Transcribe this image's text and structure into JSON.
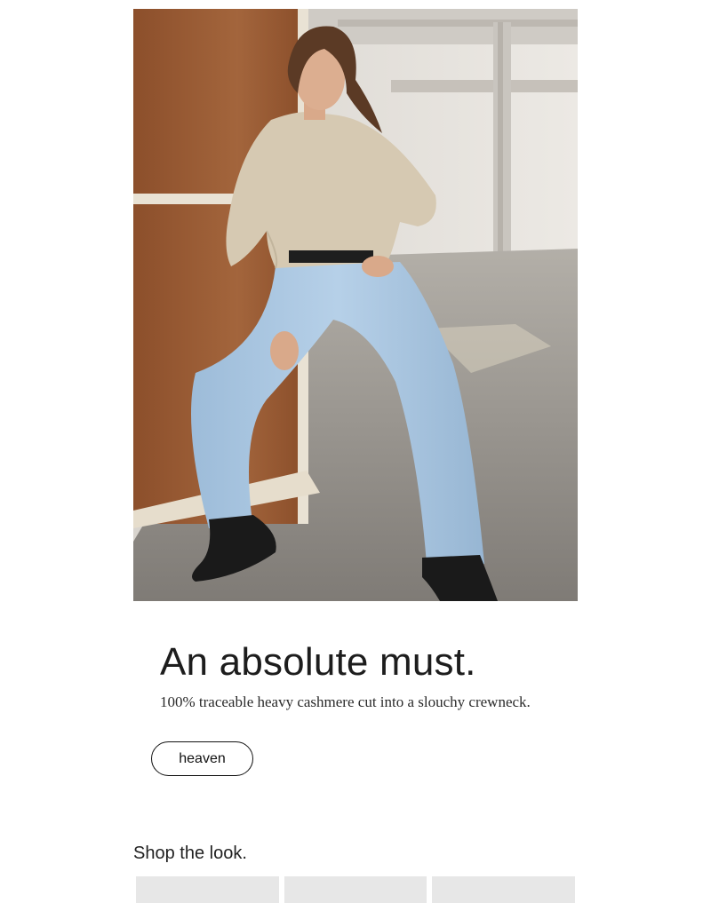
{
  "hero": {
    "image_alt": "Model wearing a beige ribbed cashmere crewneck sweater, light wash wide-leg jeans and black heeled boots, leaning against a wooden panel in a concrete warehouse",
    "palette": {
      "wood": "#9a5a33",
      "wall": "#e4e1dc",
      "floor": "#8f8b86",
      "sweater": "#d6c9b2",
      "denim": "#a9c7e3",
      "boots": "#1a1a1a"
    }
  },
  "feature": {
    "headline": "An absolute must.",
    "subtext": "100% traceable heavy cashmere cut into a slouchy crewneck.",
    "cta_label": "heaven"
  },
  "shop": {
    "title": "Shop the look.",
    "tile_color": "#e7e7e7"
  }
}
